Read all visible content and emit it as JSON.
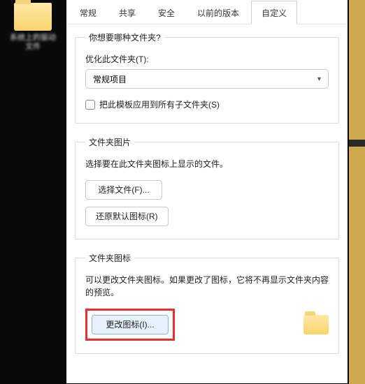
{
  "desktop": {
    "folder_label": "系统上的驱动\n文件"
  },
  "tabs": {
    "general": "常规",
    "share": "共享",
    "security": "安全",
    "previous": "以前的版本",
    "custom": "自定义"
  },
  "group_type": {
    "legend": "你想要哪种文件夹?",
    "optimize_label": "优化此文件夹(T):",
    "combo_value": "常规项目",
    "apply_subfolders": "把此模板应用到所有子文件夹(S)"
  },
  "group_picture": {
    "legend": "文件夹图片",
    "desc": "选择要在此文件夹图标上显示的文件。",
    "choose_btn": "选择文件(F)...",
    "restore_btn": "还原默认图标(R)"
  },
  "group_icon": {
    "legend": "文件夹图标",
    "desc": "可以更改文件夹图标。如果更改了图标，它将不再显示文件夹内容的预览。",
    "change_btn": "更改图标(I)..."
  }
}
